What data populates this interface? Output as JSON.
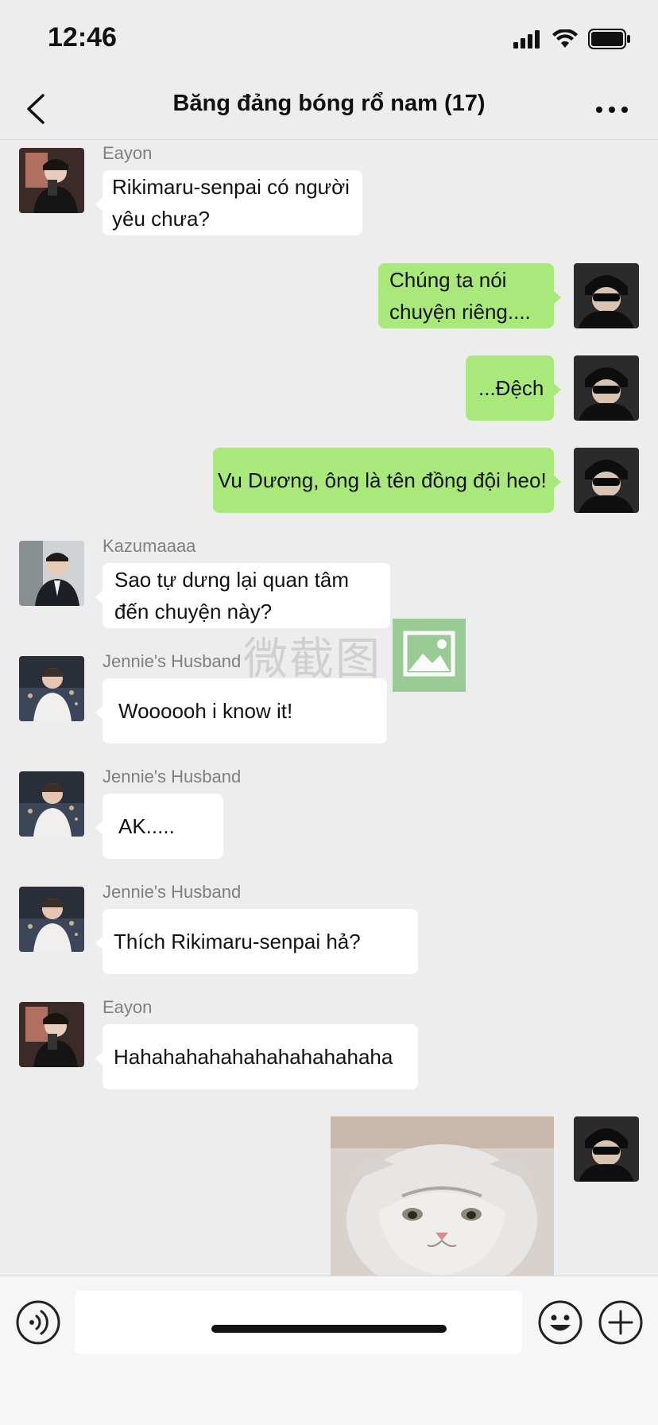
{
  "status": {
    "time": "12:46"
  },
  "nav": {
    "title": "Băng đảng bóng rổ nam (17)"
  },
  "messages": [
    {
      "side": "in",
      "sender": "Eayon",
      "text": "Rikimaru-senpai có người yêu chưa?",
      "avatar": "avatar-eayon"
    },
    {
      "side": "out",
      "text": "Chúng ta nói chuyện riêng....",
      "avatar": "avatar-self"
    },
    {
      "side": "out",
      "text": "...Đệch",
      "avatar": "avatar-self"
    },
    {
      "side": "out",
      "text": "Vu Dương, ông là tên đồng đội heo!",
      "avatar": "avatar-self"
    },
    {
      "side": "in",
      "sender": "Kazumaaaa",
      "text": "Sao tự dưng lại quan tâm đến chuyện này?",
      "avatar": "avatar-kazuma"
    },
    {
      "side": "in",
      "sender": "Jennie's Husband",
      "text": "Woooooh i know it!",
      "avatar": "avatar-jennies-husband"
    },
    {
      "side": "in",
      "sender": "Jennie's Husband",
      "text": "AK.....",
      "avatar": "avatar-jennies-husband"
    },
    {
      "side": "in",
      "sender": "Jennie's Husband",
      "text": "Thích Rikimaru-senpai hả?",
      "avatar": "avatar-jennies-husband"
    },
    {
      "side": "in",
      "sender": "Eayon",
      "text": "Hahahahahahahahahahahaha",
      "avatar": "avatar-eayon"
    },
    {
      "side": "out",
      "image": "cat-photo",
      "avatar": "avatar-self"
    }
  ],
  "watermark": {
    "text": "微截图"
  },
  "colors": {
    "background": "#ededed",
    "incoming_bubble": "#ffffff",
    "outgoing_bubble": "#a9e87a",
    "sender_name": "#7f7f7f"
  },
  "icons": {
    "back": "chevron-left-icon",
    "more": "more-dots-icon",
    "voice": "voice-icon",
    "emoji": "emoji-icon",
    "plus": "plus-icon"
  }
}
